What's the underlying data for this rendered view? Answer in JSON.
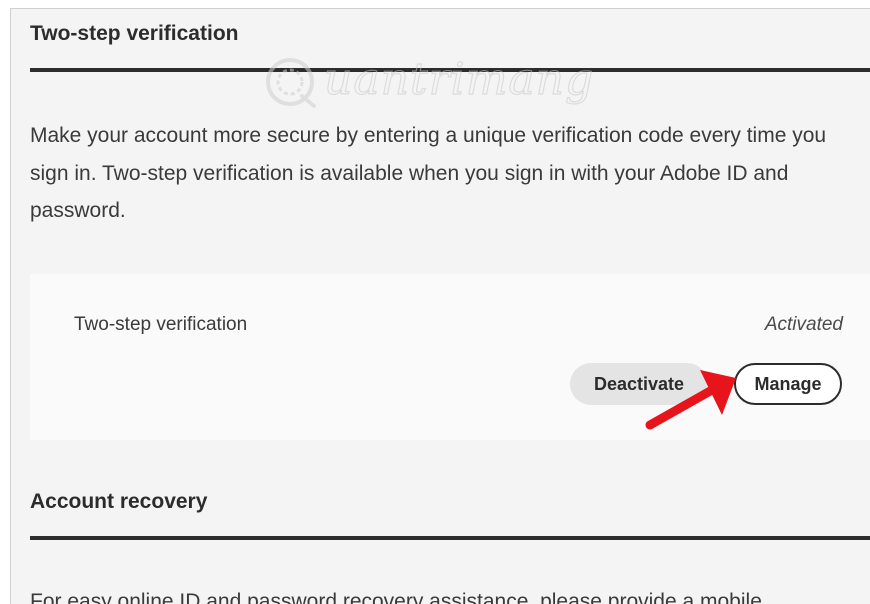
{
  "two_step_section": {
    "title": "Two-step verification",
    "description": "Make your account more secure by entering a unique verification code every time you sign in. Two-step verification is available when you sign in with your Adobe ID and password.",
    "card": {
      "label": "Two-step verification",
      "status": "Activated",
      "deactivate_label": "Deactivate",
      "manage_label": "Manage"
    }
  },
  "account_recovery_section": {
    "title": "Account recovery",
    "description_partial": "For easy online ID and password recovery assistance, please provide a mobile"
  },
  "watermark": {
    "text": "uantrimang",
    "icon": "quantrimang-logo-icon"
  },
  "annotation": {
    "icon": "red-arrow-icon",
    "color": "#e8141b"
  },
  "colors": {
    "heading": "#2c2c2c",
    "panel_bg": "#f4f4f4",
    "card_bg": "#fafafa",
    "secondary_button_bg": "#e4e4e4"
  }
}
